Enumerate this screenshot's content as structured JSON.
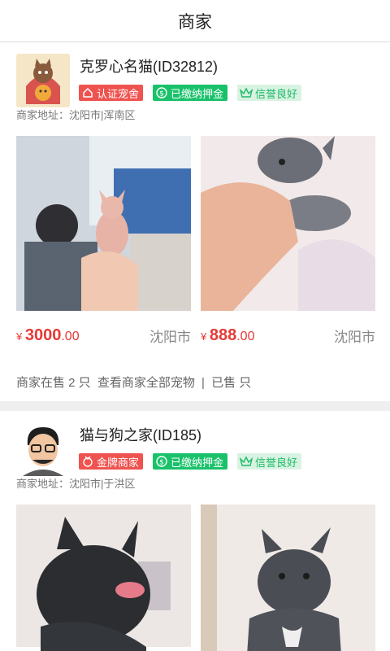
{
  "header": {
    "title": "商家"
  },
  "merchants": [
    {
      "name": "克罗心名猫(ID32812)",
      "badges": [
        {
          "label": "认证宠舍",
          "icon": "home-icon"
        },
        {
          "label": "已缴纳押金",
          "icon": "deposit-icon"
        },
        {
          "label": "信誉良好",
          "icon": "crown-icon"
        }
      ],
      "address_label": "商家地址：",
      "address": "沈阳市|浑南区",
      "pets": [
        {
          "currency": "¥",
          "price_int": "3000",
          "price_dec": ".00",
          "city": "沈阳市"
        },
        {
          "currency": "¥",
          "price_int": "888",
          "price_dec": ".00",
          "city": "沈阳市"
        }
      ],
      "stats": {
        "on_sale": "商家在售 2 只",
        "view_all": "查看商家全部宠物",
        "sold": "已售 只"
      }
    },
    {
      "name": "猫与狗之家(ID185)",
      "badges": [
        {
          "label": "金牌商家",
          "icon": "medal-icon"
        },
        {
          "label": "已缴纳押金",
          "icon": "deposit-icon"
        },
        {
          "label": "信誉良好",
          "icon": "crown-icon"
        }
      ],
      "address_label": "商家地址：",
      "address": "沈阳市|于洪区",
      "pets": [
        {
          "currency": "¥",
          "price_int": "",
          "price_dec": "",
          "city": ""
        },
        {
          "currency": "¥",
          "price_int": "",
          "price_dec": "",
          "city": ""
        }
      ]
    }
  ],
  "stats_separator": "|",
  "colors": {
    "price": "#e53935",
    "badge_red": "#ef5350",
    "badge_green": "#19c26a",
    "badge_outline": "#1fba6a"
  }
}
